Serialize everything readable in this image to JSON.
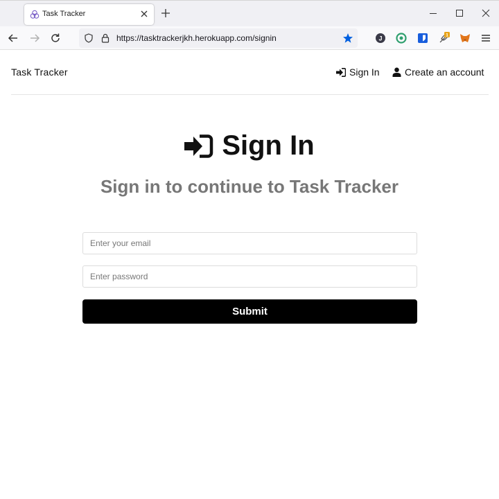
{
  "browser": {
    "tab_title": "Task Tracker",
    "url": "https://tasktrackerjkh.herokuapp.com/signin",
    "extension_badge": "1",
    "extension_j_letter": "J",
    "accent_color": "#0060df"
  },
  "header": {
    "brand": "Task Tracker",
    "signin_label": "Sign In",
    "create_account_label": "Create an account"
  },
  "hero": {
    "title": "Sign In",
    "subtitle": "Sign in to continue to Task Tracker"
  },
  "form": {
    "email_placeholder": "Enter your email",
    "email_value": "",
    "password_placeholder": "Enter password",
    "password_value": "",
    "submit_label": "Submit"
  }
}
